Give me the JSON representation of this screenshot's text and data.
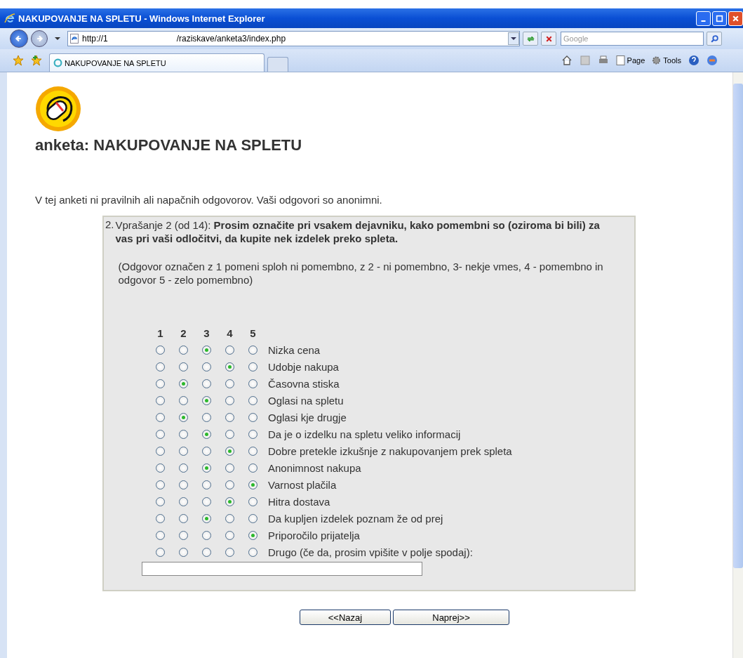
{
  "window": {
    "title": "NAKUPOVANJE NA SPLETU - Windows Internet Explorer"
  },
  "address_bar": {
    "url_start": "http://1",
    "url_end": "/raziskave/anketa3/index.php"
  },
  "search": {
    "placeholder": "Google"
  },
  "tabs": [
    {
      "label": "NAKUPOVANJE NA SPLETU",
      "selected": true
    }
  ],
  "command_bar": [
    {
      "label": "Page",
      "kind": "page"
    },
    {
      "label": "Tools",
      "kind": "tools"
    }
  ],
  "page": {
    "title": "anketa: NAKUPOVANJE NA SPLETU",
    "intro": "V tej anketi ni pravilnih ali napačnih odgovorov. Vaši odgovori so anonimni.",
    "question": {
      "number": "2.",
      "label": "Vprašanje 2 (od 14):",
      "text": "Prosim označite pri vsakem dejavniku, kako pomembni so (oziroma bi bili) za vas pri vaši odločitvi, da kupite nek izdelek preko spleta.",
      "note": "(Odgovor označen z 1 pomeni sploh ni pomembno, z 2 - ni pomembno, 3- nekje vmes, 4 - pomembno in odgovor 5 - zelo pomembno)",
      "scale": [
        "1",
        "2",
        "3",
        "4",
        "5"
      ],
      "rows": [
        {
          "label": "Nizka cena",
          "choices": [
            {
              "selected": false
            },
            {
              "selected": false
            },
            {
              "selected": true
            },
            {
              "selected": false
            },
            {
              "selected": false
            }
          ]
        },
        {
          "label": "Udobje nakupa",
          "choices": [
            {
              "selected": false
            },
            {
              "selected": false
            },
            {
              "selected": false
            },
            {
              "selected": true
            },
            {
              "selected": false
            }
          ]
        },
        {
          "label": "Časovna stiska",
          "choices": [
            {
              "selected": false
            },
            {
              "selected": true
            },
            {
              "selected": false
            },
            {
              "selected": false
            },
            {
              "selected": false
            }
          ]
        },
        {
          "label": "Oglasi na spletu",
          "choices": [
            {
              "selected": false
            },
            {
              "selected": false
            },
            {
              "selected": true
            },
            {
              "selected": false
            },
            {
              "selected": false
            }
          ]
        },
        {
          "label": "Oglasi kje drugje",
          "choices": [
            {
              "selected": false
            },
            {
              "selected": true
            },
            {
              "selected": false
            },
            {
              "selected": false
            },
            {
              "selected": false
            }
          ]
        },
        {
          "label": "Da je o izdelku na spletu veliko informacij",
          "choices": [
            {
              "selected": false
            },
            {
              "selected": false
            },
            {
              "selected": true
            },
            {
              "selected": false
            },
            {
              "selected": false
            }
          ]
        },
        {
          "label": "Dobre pretekle izkušnje z nakupovanjem prek spleta",
          "choices": [
            {
              "selected": false
            },
            {
              "selected": false
            },
            {
              "selected": false
            },
            {
              "selected": true
            },
            {
              "selected": false
            }
          ]
        },
        {
          "label": "Anonimnost nakupa",
          "choices": [
            {
              "selected": false
            },
            {
              "selected": false
            },
            {
              "selected": true
            },
            {
              "selected": false
            },
            {
              "selected": false
            }
          ]
        },
        {
          "label": "Varnost plačila",
          "choices": [
            {
              "selected": false
            },
            {
              "selected": false
            },
            {
              "selected": false
            },
            {
              "selected": false
            },
            {
              "selected": true
            }
          ]
        },
        {
          "label": "Hitra dostava",
          "choices": [
            {
              "selected": false
            },
            {
              "selected": false
            },
            {
              "selected": false
            },
            {
              "selected": true
            },
            {
              "selected": false
            }
          ]
        },
        {
          "label": "Da kupljen izdelek poznam že od prej",
          "choices": [
            {
              "selected": false
            },
            {
              "selected": false
            },
            {
              "selected": true
            },
            {
              "selected": false
            },
            {
              "selected": false
            }
          ]
        },
        {
          "label": "Priporočilo prijatelja",
          "choices": [
            {
              "selected": false
            },
            {
              "selected": false
            },
            {
              "selected": false
            },
            {
              "selected": false
            },
            {
              "selected": true
            }
          ]
        },
        {
          "label": "Drugo (če da, prosim vpišite v polje spodaj):",
          "choices": [
            {
              "selected": false
            },
            {
              "selected": false
            },
            {
              "selected": false
            },
            {
              "selected": false
            },
            {
              "selected": false
            }
          ]
        }
      ]
    },
    "buttons": [
      {
        "label": "<<Nazaj"
      },
      {
        "label": "Naprej>>"
      }
    ]
  }
}
